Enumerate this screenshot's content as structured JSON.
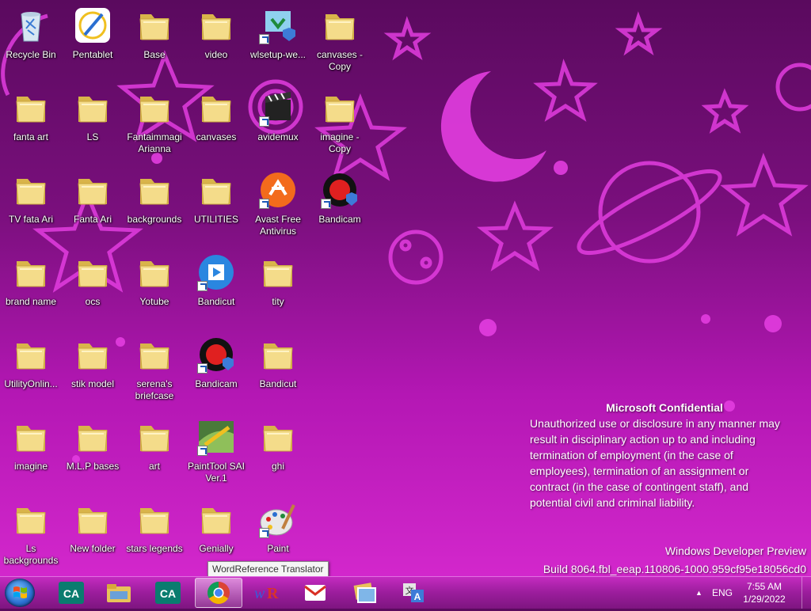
{
  "desktop": {
    "icons": [
      {
        "label": "Recycle Bin",
        "type": "recycle-bin"
      },
      {
        "label": "Pentablet",
        "type": "app"
      },
      {
        "label": "Base",
        "type": "folder"
      },
      {
        "label": "video",
        "type": "folder"
      },
      {
        "label": "wlsetup-we...",
        "type": "installer"
      },
      {
        "label": "canvases - Copy",
        "type": "folder"
      },
      {
        "label": "fanta art",
        "type": "folder"
      },
      {
        "label": "LS",
        "type": "folder"
      },
      {
        "label": "Fantaimmagi Arianna",
        "type": "folder"
      },
      {
        "label": "canvases",
        "type": "folder"
      },
      {
        "label": "avidemux",
        "type": "app"
      },
      {
        "label": "imagine - Copy",
        "type": "folder"
      },
      {
        "label": "TV fata Ari",
        "type": "folder"
      },
      {
        "label": "Fanta Ari",
        "type": "folder"
      },
      {
        "label": "backgrounds",
        "type": "folder"
      },
      {
        "label": "UTILITIES",
        "type": "folder"
      },
      {
        "label": "Avast Free Antivirus",
        "type": "app"
      },
      {
        "label": "Bandicam",
        "type": "app"
      },
      {
        "label": "brand name",
        "type": "folder"
      },
      {
        "label": "ocs",
        "type": "folder"
      },
      {
        "label": "Yotube",
        "type": "folder"
      },
      {
        "label": "Bandicut",
        "type": "app"
      },
      {
        "label": "tity",
        "type": "folder"
      },
      {
        "label": "UtilityOnlin...",
        "type": "folder"
      },
      {
        "label": "stik model",
        "type": "folder"
      },
      {
        "label": "serena's briefcase",
        "type": "folder"
      },
      {
        "label": "Bandicam",
        "type": "app"
      },
      {
        "label": "Bandicut",
        "type": "folder"
      },
      {
        "label": "imagine",
        "type": "folder"
      },
      {
        "label": "M.L.P bases",
        "type": "folder"
      },
      {
        "label": "art",
        "type": "folder"
      },
      {
        "label": "PaintTool SAI Ver.1",
        "type": "app"
      },
      {
        "label": "ghi",
        "type": "folder"
      },
      {
        "label": "Ls backgrounds",
        "type": "folder"
      },
      {
        "label": "New folder",
        "type": "folder"
      },
      {
        "label": "stars legends",
        "type": "folder"
      },
      {
        "label": "Genially",
        "type": "folder"
      },
      {
        "label": "Paint",
        "type": "app"
      }
    ]
  },
  "watermark": {
    "title": "Microsoft Confidential",
    "lines": [
      "Unauthorized use or disclosure in any manner may",
      "result in disciplinary action up to and including",
      "termination of employment (in the case of",
      "employees), termination of an assignment or",
      "contract (in the case of contingent staff), and",
      "potential civil and criminal liability."
    ],
    "edition": "Windows Developer Preview",
    "build": "Build 8064.fbl_eeap.110806-1000.959cf95e18056cd0"
  },
  "tooltip": "WordReference Translator",
  "taskbar": {
    "apps": [
      {
        "name": "credit-agricole-icon"
      },
      {
        "name": "file-explorer-icon"
      },
      {
        "name": "credit-agricole-icon"
      },
      {
        "name": "chrome-icon"
      },
      {
        "name": "wordreference-icon"
      },
      {
        "name": "gmail-icon"
      },
      {
        "name": "photos-icon"
      },
      {
        "name": "translator-icon"
      }
    ],
    "language": "ENG",
    "time": "7:55 AM",
    "date": "1/29/2022"
  }
}
